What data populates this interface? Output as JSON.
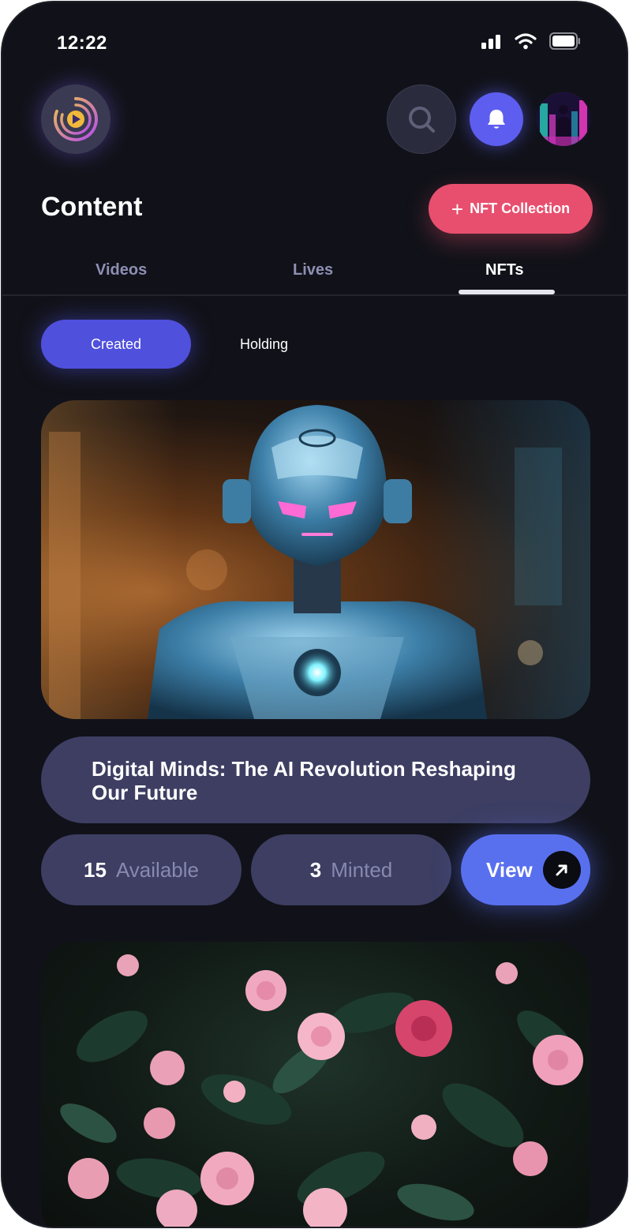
{
  "status_bar": {
    "time": "12:22"
  },
  "header": {
    "icons": {
      "logo": "play-ring-logo-icon",
      "search": "search-icon",
      "notifications": "bell-icon",
      "avatar": "user-avatar"
    }
  },
  "page": {
    "title": "Content",
    "action_label": "NFT Collection"
  },
  "tabs": [
    {
      "label": "Videos"
    },
    {
      "label": "Lives"
    },
    {
      "label": "NFTs"
    }
  ],
  "segments": [
    {
      "label": "Created"
    },
    {
      "label": "Holding"
    }
  ],
  "cards": [
    {
      "image": "robot-nft-image",
      "title": "Digital Minds: The AI Revolution Reshaping Our Future",
      "available_count": "15",
      "available_label": "Available",
      "minted_count": "3",
      "minted_label": "Minted",
      "view_label": "View"
    },
    {
      "image": "pink-flowers-nft-image"
    }
  ],
  "colors": {
    "background": "#111219",
    "primary": "#4f50dc",
    "accent_pink": "#e84f6e",
    "pill": "#3d3e62",
    "view_button": "#5870ee"
  }
}
